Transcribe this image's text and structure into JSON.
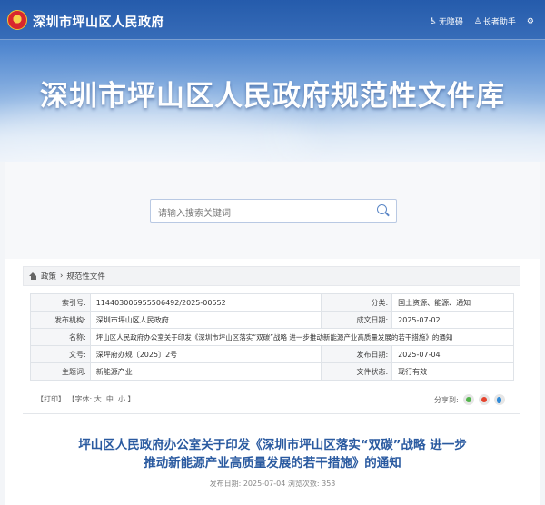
{
  "site": {
    "gov_name": "深圳市坪山区人民政府",
    "accessibility": "无障碍",
    "elder_helper": "长者助手",
    "banner_title": "深圳市坪山区人民政府规范性文件库"
  },
  "search": {
    "placeholder": "请输入搜索关键词"
  },
  "breadcrumb": {
    "items": [
      "政策",
      "规范性文件"
    ],
    "separator": "›"
  },
  "meta": {
    "index_no_label": "索引号:",
    "index_no": "114403006955506492/2025-00552",
    "category_label": "分类:",
    "category": "国土资源、能源、通知",
    "issuer_label": "发布机构:",
    "issuer": "深圳市坪山区人民政府",
    "date_made_label": "成文日期:",
    "date_made": "2025-07-02",
    "name_label": "名称:",
    "name": "坪山区人民政府办公室关于印发《深圳市坪山区落实“双碳”战略 进一步推动新能源产业高质量发展的若干措施》的通知",
    "doc_no_label": "文号:",
    "doc_no": "深坪府办规〔2025〕2号",
    "pub_date_label": "发布日期:",
    "pub_date": "2025-07-04",
    "keyword_label": "主题词:",
    "keyword": "新能源产业",
    "status_label": "文件状态:",
    "status": "现行有效"
  },
  "toolbar": {
    "print": "【打印】",
    "font_prefix": "【字体:",
    "font_large": "大",
    "font_medium": "中",
    "font_small": "小",
    "font_suffix": "】",
    "share_label": "分享到:"
  },
  "article": {
    "title_line1": "坪山区人民政府办公室关于印发《深圳市坪山区落实“双碳”战略 进一步",
    "title_line2": "推动新能源产业高质量发展的若干措施》的通知",
    "pub_label": "发布日期:",
    "pub_date": "2025-07-04",
    "views_label": "浏览次数:",
    "views": "353"
  },
  "colors": {
    "accent": "#2a5aa0",
    "banner": "#4f86cf"
  }
}
